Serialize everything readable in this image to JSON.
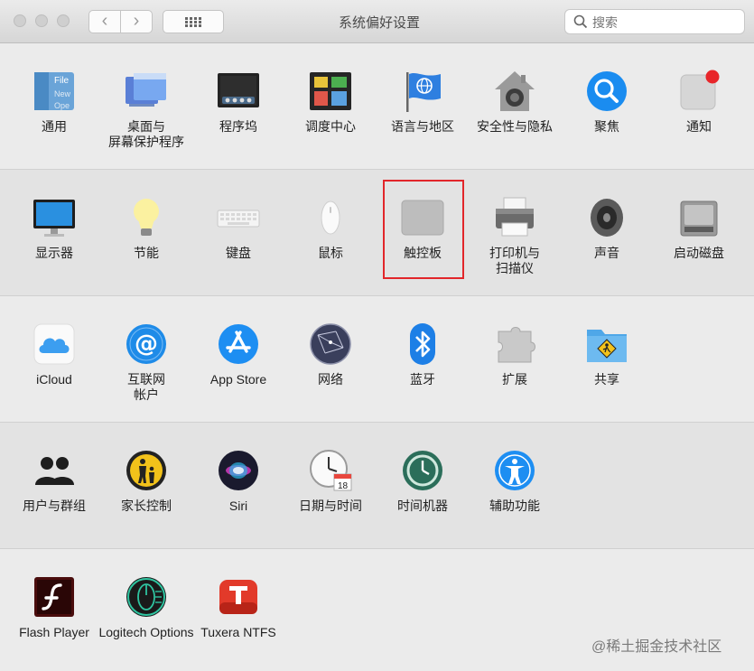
{
  "window": {
    "title": "系统偏好设置"
  },
  "toolbar": {
    "back": "‹",
    "forward": "›"
  },
  "search": {
    "placeholder": "搜索"
  },
  "rows": [
    [
      "通用",
      "桌面与\n屏幕保护程序",
      "程序坞",
      "调度中心",
      "语言与地区",
      "安全性与隐私",
      "聚焦",
      "通知"
    ],
    [
      "显示器",
      "节能",
      "键盘",
      "鼠标",
      "触控板",
      "打印机与\n扫描仪",
      "声音",
      "启动磁盘"
    ],
    [
      "iCloud",
      "互联网\n帐户",
      "App Store",
      "网络",
      "蓝牙",
      "扩展",
      "共享"
    ],
    [
      "用户与群组",
      "家长控制",
      "Siri",
      "日期与时间",
      "时间机器",
      "辅助功能"
    ],
    [
      "Flash Player",
      "Logitech Options",
      "Tuxera NTFS"
    ]
  ],
  "calendar_day": "18",
  "watermark": "@稀土掘金技术社区",
  "colors": {
    "highlight": "#e2262a",
    "accent_blue": "#1a8cf0"
  }
}
